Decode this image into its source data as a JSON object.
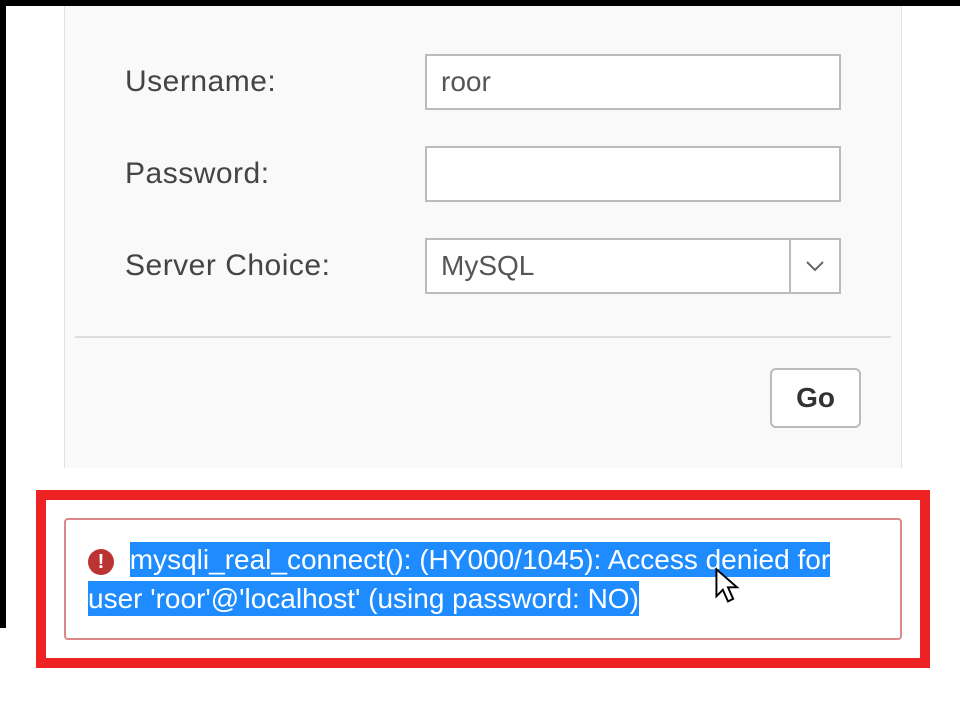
{
  "form": {
    "username_label": "Username:",
    "username_value": "roor",
    "password_label": "Password:",
    "password_value": "",
    "server_label": "Server Choice:",
    "server_selected": "MySQL",
    "go_label": "Go"
  },
  "error": {
    "message": "mysqli_real_connect(): (HY000/1045): Access denied for user 'roor'@'localhost' (using password: NO)"
  }
}
